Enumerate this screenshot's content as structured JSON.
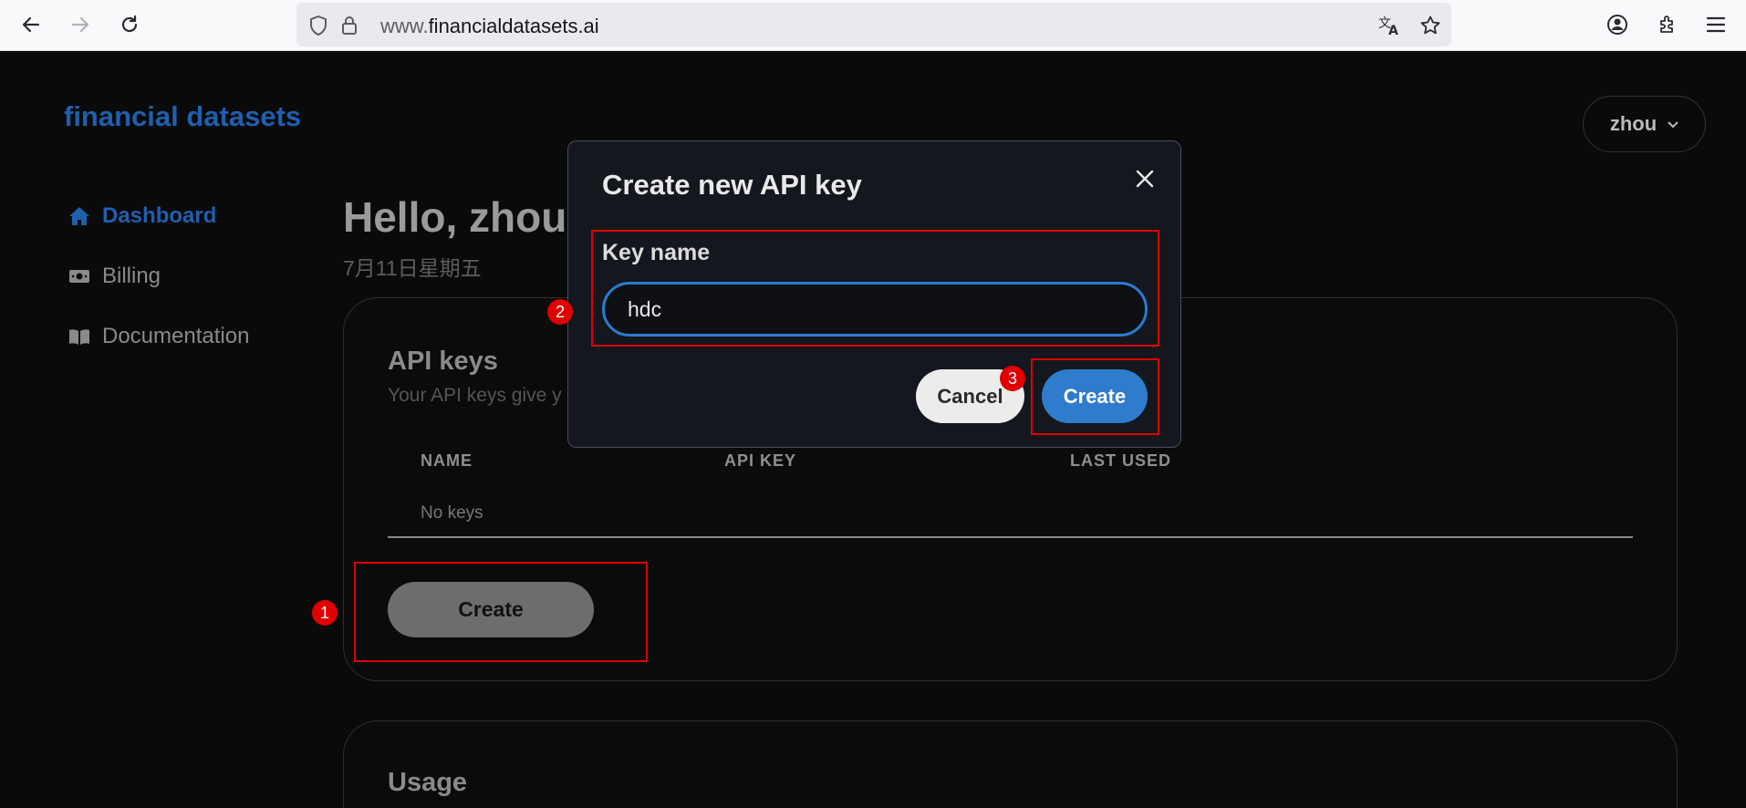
{
  "browser": {
    "url_prefix": "www.",
    "url_domain": "financialdatasets.ai"
  },
  "app": {
    "brand": "financial datasets",
    "user_menu_label": "zhou"
  },
  "sidebar": {
    "items": [
      {
        "label": "Dashboard",
        "icon": "home-icon",
        "active": true
      },
      {
        "label": "Billing",
        "icon": "money-icon",
        "active": false
      },
      {
        "label": "Documentation",
        "icon": "book-icon",
        "active": false
      }
    ]
  },
  "main": {
    "greeting": "Hello, zhou",
    "date": "7月11日星期五",
    "api_keys": {
      "title": "API keys",
      "description": "Your API keys give y",
      "columns": [
        "NAME",
        "API KEY",
        "LAST USED"
      ],
      "empty_text": "No keys",
      "create_label": "Create"
    },
    "usage": {
      "title": "Usage"
    }
  },
  "modal": {
    "title": "Create new API key",
    "field_label": "Key name",
    "field_value": "hdc",
    "cancel_label": "Cancel",
    "create_label": "Create"
  },
  "annotations": {
    "badges": [
      "1",
      "2",
      "3"
    ],
    "color": "#e00000"
  }
}
